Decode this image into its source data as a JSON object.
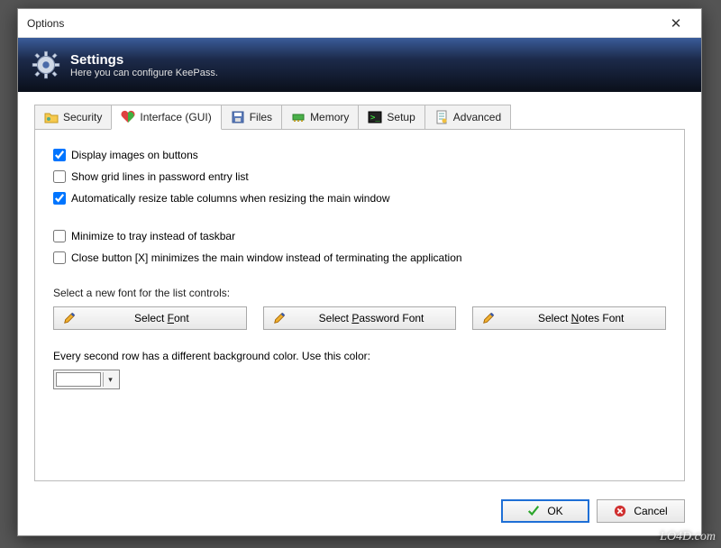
{
  "window": {
    "title": "Options"
  },
  "banner": {
    "title": "Settings",
    "subtitle": "Here you can configure KeePass."
  },
  "tabs": {
    "security": "Security",
    "interface": "Interface (GUI)",
    "files": "Files",
    "memory": "Memory",
    "setup": "Setup",
    "advanced": "Advanced"
  },
  "checks": {
    "display_images": {
      "label": "Display images on buttons",
      "checked": true
    },
    "grid_lines": {
      "label": "Show grid lines in password entry list",
      "checked": false
    },
    "auto_resize": {
      "label": "Automatically resize table columns when resizing the main window",
      "checked": true
    },
    "min_tray": {
      "label": "Minimize to tray instead of taskbar",
      "checked": false
    },
    "close_min": {
      "label": "Close button [X] minimizes the main window instead of terminating the application",
      "checked": false
    }
  },
  "font_section": {
    "label": "Select a new font for the list controls:",
    "select_font": "Select Font",
    "select_pw_font": "Select Password Font",
    "select_notes_font": "Select Notes Font"
  },
  "color_section": {
    "label": "Every second row has a different background color. Use this color:",
    "swatch": "#ffffff"
  },
  "footer": {
    "ok": "OK",
    "cancel": "Cancel"
  },
  "watermark": "LO4D.com"
}
